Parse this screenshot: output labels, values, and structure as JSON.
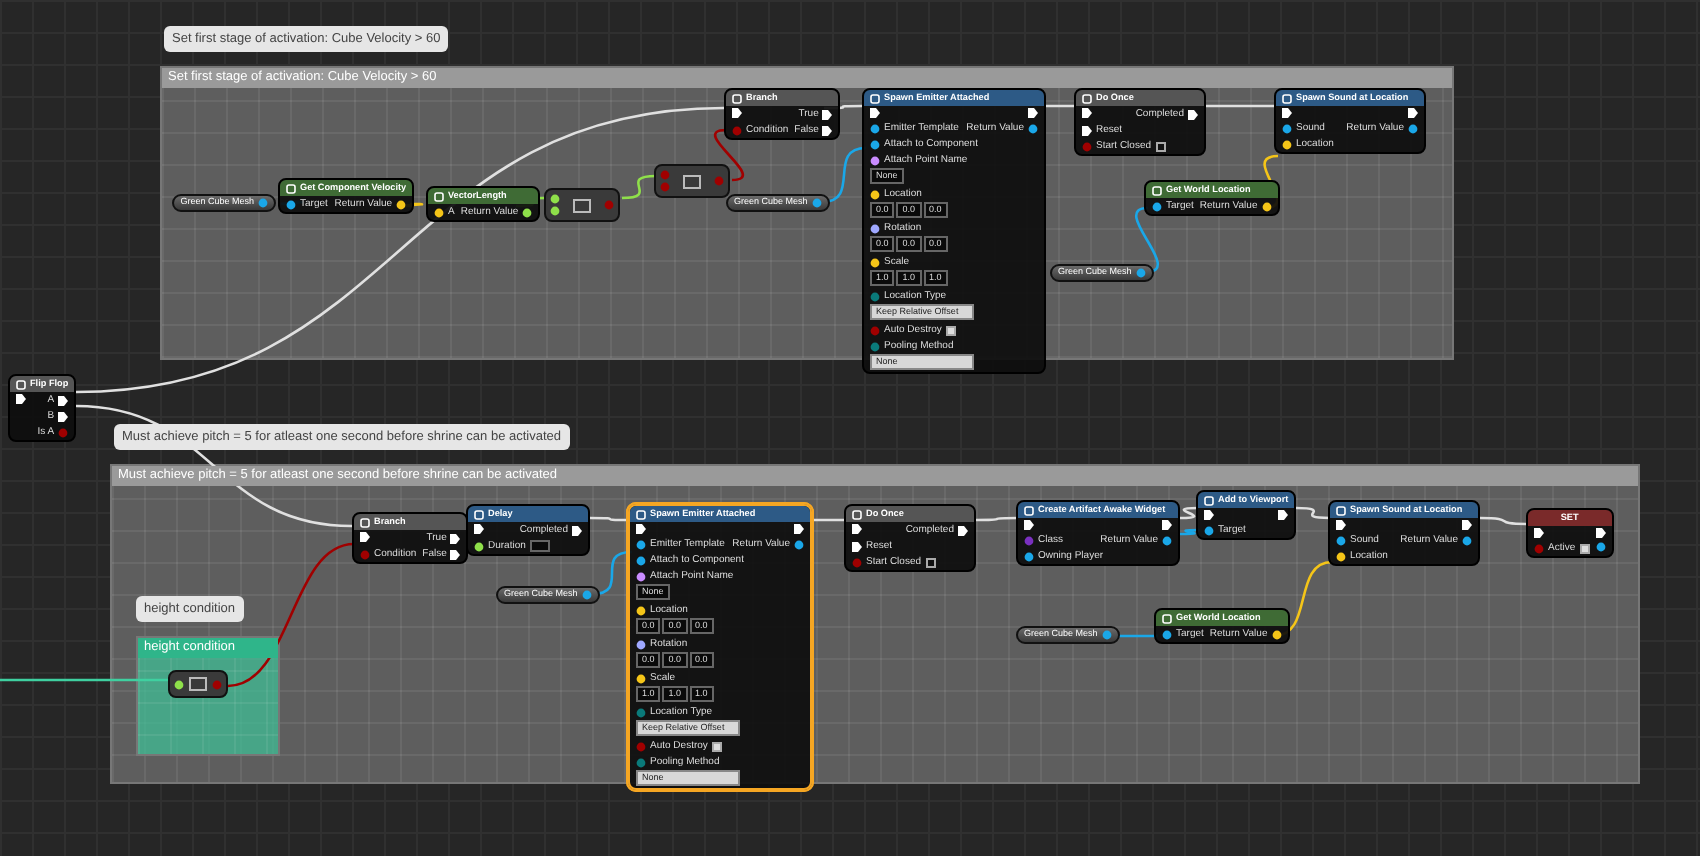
{
  "comments": [
    {
      "bubble": "Set first stage of activation: Cube Velocity > 60",
      "title": "Set first stage of activation: Cube Velocity > 60",
      "color": "#9a9a9a"
    },
    {
      "bubble": "Must achieve pitch = 5 for atleast one second before shrine can be activated",
      "title": "Must achieve pitch = 5 for atleast one second before shrine can be activated",
      "color": "#9a9a9a"
    },
    {
      "bubble": "height condition",
      "title": "height condition",
      "color": "#2fb58a"
    }
  ],
  "nodes": [
    {
      "kind": "variable",
      "title": "Green Cube Mesh",
      "selected": false
    },
    {
      "kind": "function",
      "title": "Get Component Velocity",
      "color": "#3f6b35",
      "selected": false,
      "inputs": [
        {
          "kind": "object",
          "label": "Target"
        }
      ],
      "outputs": [
        {
          "kind": "vector",
          "label": "Return Value"
        }
      ]
    },
    {
      "kind": "function",
      "title": "VectorLength",
      "color": "#3f6b35",
      "selected": false,
      "inputs": [
        {
          "kind": "vector",
          "label": "A"
        }
      ],
      "outputs": [
        {
          "kind": "float",
          "label": "Return Value"
        }
      ]
    },
    {
      "kind": "compact",
      "selected": false,
      "inputs": [
        {
          "kind": "float"
        },
        {
          "kind": "float"
        }
      ],
      "outputs": [
        {
          "kind": "bool"
        }
      ]
    },
    {
      "kind": "compact",
      "selected": false,
      "inputs": [
        {
          "kind": "bool"
        },
        {
          "kind": "bool"
        }
      ],
      "outputs": [
        {
          "kind": "bool"
        }
      ]
    },
    {
      "kind": "function",
      "title": "Branch",
      "color": "#555555",
      "selected": false,
      "inputs": [
        {
          "kind": "exec"
        },
        {
          "kind": "bool",
          "label": "Condition"
        }
      ],
      "outputs": [
        {
          "kind": "exec",
          "label": "True"
        },
        {
          "kind": "exec",
          "label": "False"
        }
      ]
    },
    {
      "kind": "variable",
      "title": "Green Cube Mesh",
      "selected": false
    },
    {
      "kind": "function",
      "title": "Spawn Emitter Attached",
      "color": "#2d5a86",
      "selected": false,
      "inputs": [
        {
          "kind": "exec"
        },
        {
          "kind": "object",
          "label": "Emitter Template"
        },
        {
          "kind": "object",
          "label": "Attach to Component"
        },
        {
          "kind": "name",
          "label": "Attach Point Name",
          "value": "None"
        },
        {
          "kind": "vector",
          "label": "Location",
          "values": [
            "0.0",
            "0.0",
            "0.0"
          ]
        },
        {
          "kind": "rotator",
          "label": "Rotation",
          "values": [
            "0.0",
            "0.0",
            "0.0"
          ]
        },
        {
          "kind": "vector",
          "label": "Scale",
          "values": [
            "1.0",
            "1.0",
            "1.0"
          ]
        },
        {
          "kind": "byte",
          "label": "Location Type",
          "choice": "Keep Relative Offset"
        },
        {
          "kind": "bool",
          "label": "Auto Destroy",
          "checked": true
        },
        {
          "kind": "byte",
          "label": "Pooling Method",
          "choice": "None"
        }
      ],
      "outputs": [
        {
          "kind": "exec"
        },
        {
          "kind": "object",
          "label": "Return Value"
        }
      ]
    },
    {
      "kind": "function",
      "title": "Do Once",
      "color": "#555555",
      "selected": false,
      "inputs": [
        {
          "kind": "exec"
        },
        {
          "kind": "exec",
          "label": "Reset"
        },
        {
          "kind": "bool",
          "label": "Start Closed",
          "checked": false
        }
      ],
      "outputs": [
        {
          "kind": "exec",
          "label": "Completed"
        }
      ]
    },
    {
      "kind": "function",
      "title": "Get World Location",
      "color": "#3f6b35",
      "selected": false,
      "inputs": [
        {
          "kind": "object",
          "label": "Target"
        }
      ],
      "outputs": [
        {
          "kind": "vector",
          "label": "Return Value"
        }
      ]
    },
    {
      "kind": "variable",
      "title": "Green Cube Mesh",
      "selected": false
    },
    {
      "kind": "function",
      "title": "Spawn Sound at Location",
      "color": "#2d5a86",
      "selected": false,
      "inputs": [
        {
          "kind": "exec"
        },
        {
          "kind": "object",
          "label": "Sound"
        },
        {
          "kind": "vector",
          "label": "Location"
        }
      ],
      "outputs": [
        {
          "kind": "exec"
        },
        {
          "kind": "object",
          "label": "Return Value"
        }
      ]
    },
    {
      "kind": "function",
      "title": "Flip Flop",
      "color": "#555555",
      "selected": false,
      "inputs": [
        {
          "kind": "exec"
        }
      ],
      "outputs": [
        {
          "kind": "exec",
          "label": "A"
        },
        {
          "kind": "exec",
          "label": "B"
        },
        {
          "kind": "bool",
          "label": "Is A"
        }
      ]
    },
    {
      "kind": "function",
      "title": "Branch",
      "color": "#555555",
      "selected": false,
      "inputs": [
        {
          "kind": "exec"
        },
        {
          "kind": "bool",
          "label": "Condition"
        }
      ],
      "outputs": [
        {
          "kind": "exec",
          "label": "True"
        },
        {
          "kind": "exec",
          "label": "False"
        }
      ]
    },
    {
      "kind": "function",
      "title": "Delay",
      "color": "#2d5a86",
      "selected": false,
      "inputs": [
        {
          "kind": "exec"
        },
        {
          "kind": "float",
          "label": "Duration"
        }
      ],
      "outputs": [
        {
          "kind": "exec",
          "label": "Completed"
        }
      ]
    },
    {
      "kind": "variable",
      "title": "Green Cube Mesh",
      "selected": false
    },
    {
      "kind": "function",
      "title": "Spawn Emitter Attached",
      "color": "#2d5a86",
      "selected": true,
      "inputs": [
        {
          "kind": "exec"
        },
        {
          "kind": "object",
          "label": "Emitter Template"
        },
        {
          "kind": "object",
          "label": "Attach to Component"
        },
        {
          "kind": "name",
          "label": "Attach Point Name",
          "value": "None"
        },
        {
          "kind": "vector",
          "label": "Location",
          "values": [
            "0.0",
            "0.0",
            "0.0"
          ]
        },
        {
          "kind": "rotator",
          "label": "Rotation",
          "values": [
            "0.0",
            "0.0",
            "0.0"
          ]
        },
        {
          "kind": "vector",
          "label": "Scale",
          "values": [
            "1.0",
            "1.0",
            "1.0"
          ]
        },
        {
          "kind": "byte",
          "label": "Location Type",
          "choice": "Keep Relative Offset"
        },
        {
          "kind": "bool",
          "label": "Auto Destroy",
          "checked": true
        },
        {
          "kind": "byte",
          "label": "Pooling Method",
          "choice": "None"
        }
      ],
      "outputs": [
        {
          "kind": "exec"
        },
        {
          "kind": "object",
          "label": "Return Value"
        }
      ]
    },
    {
      "kind": "function",
      "title": "Do Once",
      "color": "#555555",
      "selected": false,
      "inputs": [
        {
          "kind": "exec"
        },
        {
          "kind": "exec",
          "label": "Reset"
        },
        {
          "kind": "bool",
          "label": "Start Closed",
          "checked": false
        }
      ],
      "outputs": [
        {
          "kind": "exec",
          "label": "Completed"
        }
      ]
    },
    {
      "kind": "function",
      "title": "Create Artifact Awake Widget",
      "color": "#2d5a86",
      "selected": false,
      "inputs": [
        {
          "kind": "exec"
        },
        {
          "kind": "class",
          "label": "Class"
        },
        {
          "kind": "object",
          "label": "Owning Player"
        }
      ],
      "outputs": [
        {
          "kind": "exec"
        },
        {
          "kind": "object",
          "label": "Return Value"
        }
      ]
    },
    {
      "kind": "function",
      "title": "Add to Viewport",
      "color": "#2d5a86",
      "selected": false,
      "inputs": [
        {
          "kind": "exec"
        },
        {
          "kind": "object",
          "label": "Target"
        }
      ],
      "outputs": [
        {
          "kind": "exec"
        }
      ]
    },
    {
      "kind": "function",
      "title": "Spawn Sound at Location",
      "color": "#2d5a86",
      "selected": false,
      "inputs": [
        {
          "kind": "exec"
        },
        {
          "kind": "object",
          "label": "Sound"
        },
        {
          "kind": "vector",
          "label": "Location"
        }
      ],
      "outputs": [
        {
          "kind": "exec"
        },
        {
          "kind": "object",
          "label": "Return Value"
        }
      ]
    },
    {
      "kind": "set",
      "title": "SET",
      "color": "#7a2a2a",
      "selected": false,
      "inputs": [
        {
          "kind": "exec"
        },
        {
          "kind": "bool",
          "label": "Active",
          "checked": true
        }
      ],
      "outputs": [
        {
          "kind": "exec"
        },
        {
          "kind": "object"
        }
      ]
    },
    {
      "kind": "variable",
      "title": "Green Cube Mesh",
      "selected": false
    },
    {
      "kind": "function",
      "title": "Get World Location",
      "color": "#3f6b35",
      "selected": false,
      "inputs": [
        {
          "kind": "object",
          "label": "Target"
        }
      ],
      "outputs": [
        {
          "kind": "vector",
          "label": "Return Value"
        }
      ]
    },
    {
      "kind": "compact",
      "selected": false,
      "inputs": [
        {
          "kind": "float"
        }
      ],
      "outputs": [
        {
          "kind": "bool"
        }
      ]
    }
  ]
}
